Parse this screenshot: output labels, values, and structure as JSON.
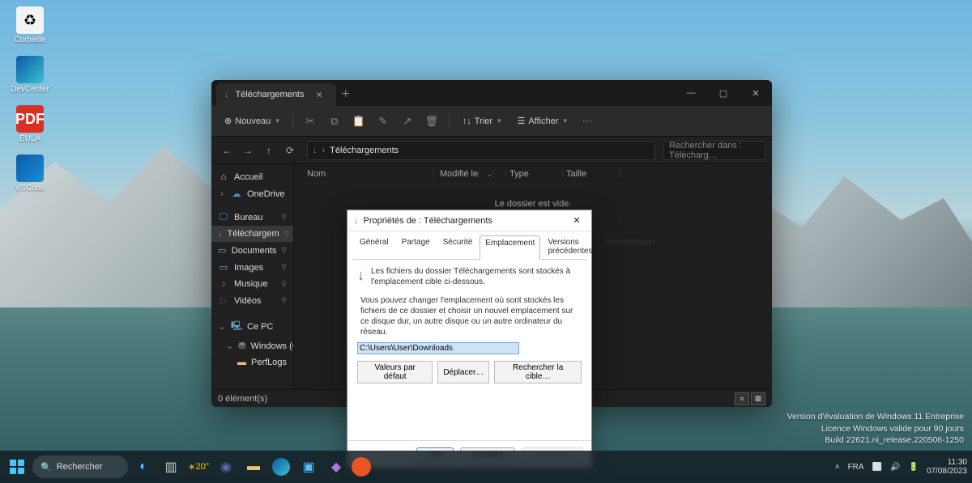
{
  "desktop": {
    "icons": [
      {
        "label": "Corbeille",
        "kind": "recycle"
      },
      {
        "label": "DevCenter",
        "kind": "edge"
      },
      {
        "label": "EULA",
        "kind": "pdf",
        "badge": "PDF"
      },
      {
        "label": "VSCode",
        "kind": "vscode"
      }
    ]
  },
  "explorer": {
    "tab_title": "Téléchargements",
    "toolbar": {
      "new": "Nouveau",
      "sort": "Trier",
      "view": "Afficher"
    },
    "address": "Téléchargements",
    "search_placeholder": "Rechercher dans : Télécharg…",
    "columns": {
      "name": "Nom",
      "modified": "Modifié le",
      "type": "Type",
      "size": "Taille"
    },
    "empty": "Le dossier est vide.",
    "sidebar": {
      "home": "Accueil",
      "onedrive": "OneDrive",
      "quick": [
        {
          "label": "Bureau"
        },
        {
          "label": "Téléchargem"
        },
        {
          "label": "Documents"
        },
        {
          "label": "Images"
        },
        {
          "label": "Musique"
        },
        {
          "label": "Vidéos"
        }
      ],
      "thispc": "Ce PC",
      "drive": "Windows (C:)",
      "folder": "PerfLogs"
    },
    "status": "0 élément(s)"
  },
  "props": {
    "title": "Propriétés de : Téléchargements",
    "tabs": {
      "general": "Général",
      "share": "Partage",
      "security": "Sécurité",
      "location": "Emplacement",
      "previous": "Versions précédentes",
      "custom": "Personnaliser"
    },
    "line1": "Les fichiers du dossier Téléchargements sont stockés à l'emplacement cible ci-dessous.",
    "line2": "Vous pouvez changer l'emplacement où sont stockés les fichiers de ce dossier et choisir un nouvel emplacement sur ce disque dur, un autre disque ou un autre ordinateur du réseau.",
    "path": "C:\\Users\\User\\Downloads",
    "btn_defaults": "Valeurs par défaut",
    "btn_move": "Déplacer…",
    "btn_find": "Rechercher la cible…",
    "ok": "OK",
    "cancel": "Annuler",
    "apply": "Appliquer"
  },
  "watermark": {
    "l1": "Version d'évaluation de Windows 11 Entreprise",
    "l2": "Licence Windows valide pour 90 jours",
    "l3": "Build 22621.ni_release.220506-1250"
  },
  "taskbar": {
    "search": "Rechercher",
    "weather": "20°",
    "lang": "FRA",
    "time": "11:30",
    "date": "07/08/2023"
  }
}
